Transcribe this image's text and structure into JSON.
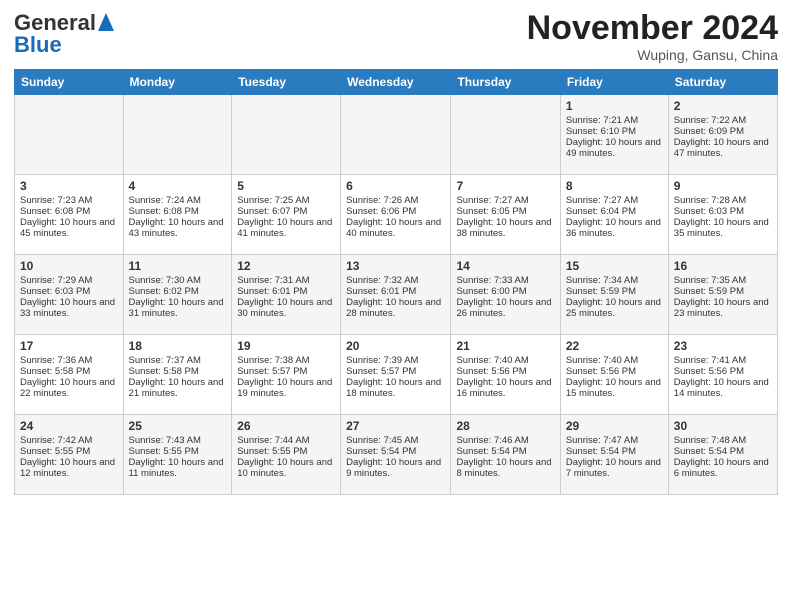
{
  "header": {
    "logo_general": "General",
    "logo_blue": "Blue",
    "month_title": "November 2024",
    "location": "Wuping, Gansu, China"
  },
  "days_of_week": [
    "Sunday",
    "Monday",
    "Tuesday",
    "Wednesday",
    "Thursday",
    "Friday",
    "Saturday"
  ],
  "weeks": [
    [
      {
        "day": "",
        "sunrise": "",
        "sunset": "",
        "daylight": ""
      },
      {
        "day": "",
        "sunrise": "",
        "sunset": "",
        "daylight": ""
      },
      {
        "day": "",
        "sunrise": "",
        "sunset": "",
        "daylight": ""
      },
      {
        "day": "",
        "sunrise": "",
        "sunset": "",
        "daylight": ""
      },
      {
        "day": "",
        "sunrise": "",
        "sunset": "",
        "daylight": ""
      },
      {
        "day": "1",
        "sunrise": "Sunrise: 7:21 AM",
        "sunset": "Sunset: 6:10 PM",
        "daylight": "Daylight: 10 hours and 49 minutes."
      },
      {
        "day": "2",
        "sunrise": "Sunrise: 7:22 AM",
        "sunset": "Sunset: 6:09 PM",
        "daylight": "Daylight: 10 hours and 47 minutes."
      }
    ],
    [
      {
        "day": "3",
        "sunrise": "Sunrise: 7:23 AM",
        "sunset": "Sunset: 6:08 PM",
        "daylight": "Daylight: 10 hours and 45 minutes."
      },
      {
        "day": "4",
        "sunrise": "Sunrise: 7:24 AM",
        "sunset": "Sunset: 6:08 PM",
        "daylight": "Daylight: 10 hours and 43 minutes."
      },
      {
        "day": "5",
        "sunrise": "Sunrise: 7:25 AM",
        "sunset": "Sunset: 6:07 PM",
        "daylight": "Daylight: 10 hours and 41 minutes."
      },
      {
        "day": "6",
        "sunrise": "Sunrise: 7:26 AM",
        "sunset": "Sunset: 6:06 PM",
        "daylight": "Daylight: 10 hours and 40 minutes."
      },
      {
        "day": "7",
        "sunrise": "Sunrise: 7:27 AM",
        "sunset": "Sunset: 6:05 PM",
        "daylight": "Daylight: 10 hours and 38 minutes."
      },
      {
        "day": "8",
        "sunrise": "Sunrise: 7:27 AM",
        "sunset": "Sunset: 6:04 PM",
        "daylight": "Daylight: 10 hours and 36 minutes."
      },
      {
        "day": "9",
        "sunrise": "Sunrise: 7:28 AM",
        "sunset": "Sunset: 6:03 PM",
        "daylight": "Daylight: 10 hours and 35 minutes."
      }
    ],
    [
      {
        "day": "10",
        "sunrise": "Sunrise: 7:29 AM",
        "sunset": "Sunset: 6:03 PM",
        "daylight": "Daylight: 10 hours and 33 minutes."
      },
      {
        "day": "11",
        "sunrise": "Sunrise: 7:30 AM",
        "sunset": "Sunset: 6:02 PM",
        "daylight": "Daylight: 10 hours and 31 minutes."
      },
      {
        "day": "12",
        "sunrise": "Sunrise: 7:31 AM",
        "sunset": "Sunset: 6:01 PM",
        "daylight": "Daylight: 10 hours and 30 minutes."
      },
      {
        "day": "13",
        "sunrise": "Sunrise: 7:32 AM",
        "sunset": "Sunset: 6:01 PM",
        "daylight": "Daylight: 10 hours and 28 minutes."
      },
      {
        "day": "14",
        "sunrise": "Sunrise: 7:33 AM",
        "sunset": "Sunset: 6:00 PM",
        "daylight": "Daylight: 10 hours and 26 minutes."
      },
      {
        "day": "15",
        "sunrise": "Sunrise: 7:34 AM",
        "sunset": "Sunset: 5:59 PM",
        "daylight": "Daylight: 10 hours and 25 minutes."
      },
      {
        "day": "16",
        "sunrise": "Sunrise: 7:35 AM",
        "sunset": "Sunset: 5:59 PM",
        "daylight": "Daylight: 10 hours and 23 minutes."
      }
    ],
    [
      {
        "day": "17",
        "sunrise": "Sunrise: 7:36 AM",
        "sunset": "Sunset: 5:58 PM",
        "daylight": "Daylight: 10 hours and 22 minutes."
      },
      {
        "day": "18",
        "sunrise": "Sunrise: 7:37 AM",
        "sunset": "Sunset: 5:58 PM",
        "daylight": "Daylight: 10 hours and 21 minutes."
      },
      {
        "day": "19",
        "sunrise": "Sunrise: 7:38 AM",
        "sunset": "Sunset: 5:57 PM",
        "daylight": "Daylight: 10 hours and 19 minutes."
      },
      {
        "day": "20",
        "sunrise": "Sunrise: 7:39 AM",
        "sunset": "Sunset: 5:57 PM",
        "daylight": "Daylight: 10 hours and 18 minutes."
      },
      {
        "day": "21",
        "sunrise": "Sunrise: 7:40 AM",
        "sunset": "Sunset: 5:56 PM",
        "daylight": "Daylight: 10 hours and 16 minutes."
      },
      {
        "day": "22",
        "sunrise": "Sunrise: 7:40 AM",
        "sunset": "Sunset: 5:56 PM",
        "daylight": "Daylight: 10 hours and 15 minutes."
      },
      {
        "day": "23",
        "sunrise": "Sunrise: 7:41 AM",
        "sunset": "Sunset: 5:56 PM",
        "daylight": "Daylight: 10 hours and 14 minutes."
      }
    ],
    [
      {
        "day": "24",
        "sunrise": "Sunrise: 7:42 AM",
        "sunset": "Sunset: 5:55 PM",
        "daylight": "Daylight: 10 hours and 12 minutes."
      },
      {
        "day": "25",
        "sunrise": "Sunrise: 7:43 AM",
        "sunset": "Sunset: 5:55 PM",
        "daylight": "Daylight: 10 hours and 11 minutes."
      },
      {
        "day": "26",
        "sunrise": "Sunrise: 7:44 AM",
        "sunset": "Sunset: 5:55 PM",
        "daylight": "Daylight: 10 hours and 10 minutes."
      },
      {
        "day": "27",
        "sunrise": "Sunrise: 7:45 AM",
        "sunset": "Sunset: 5:54 PM",
        "daylight": "Daylight: 10 hours and 9 minutes."
      },
      {
        "day": "28",
        "sunrise": "Sunrise: 7:46 AM",
        "sunset": "Sunset: 5:54 PM",
        "daylight": "Daylight: 10 hours and 8 minutes."
      },
      {
        "day": "29",
        "sunrise": "Sunrise: 7:47 AM",
        "sunset": "Sunset: 5:54 PM",
        "daylight": "Daylight: 10 hours and 7 minutes."
      },
      {
        "day": "30",
        "sunrise": "Sunrise: 7:48 AM",
        "sunset": "Sunset: 5:54 PM",
        "daylight": "Daylight: 10 hours and 6 minutes."
      }
    ]
  ]
}
